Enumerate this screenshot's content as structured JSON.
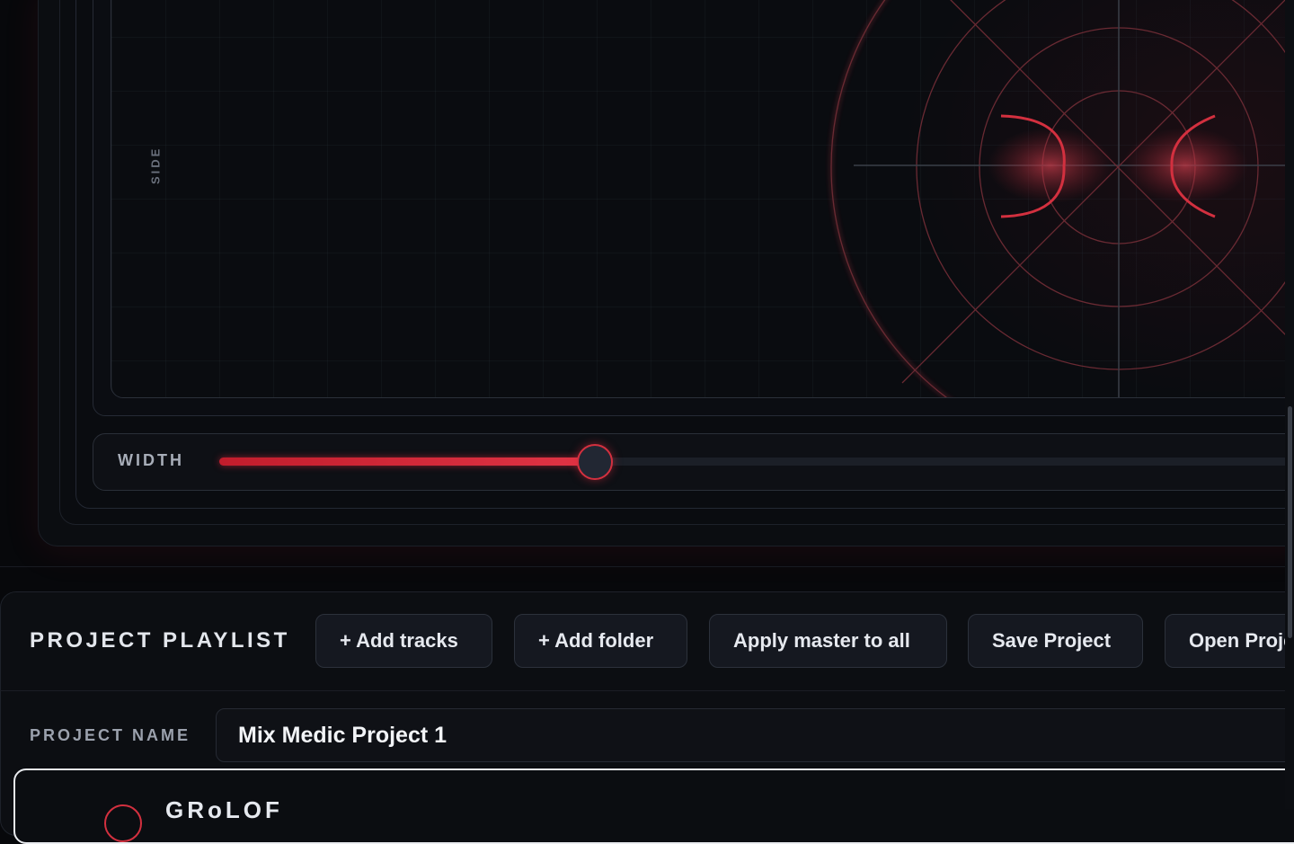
{
  "scope": {
    "side_label": "SIDE"
  },
  "width_control": {
    "label": "WIDTH",
    "value_fraction": 0.347
  },
  "playlist": {
    "title": "PROJECT PLAYLIST",
    "buttons": [
      {
        "label": "+ Add tracks"
      },
      {
        "label": "+ Add folder"
      },
      {
        "label": "Apply master to all"
      },
      {
        "label": "Save Project"
      },
      {
        "label": "Open Project"
      }
    ],
    "project_name_label": "PROJECT NAME",
    "project_name_value": "Mix Medic Project 1",
    "first_track_name": "GRoLOF"
  },
  "colors": {
    "accent": "#d3303f",
    "background": "#07080b"
  }
}
